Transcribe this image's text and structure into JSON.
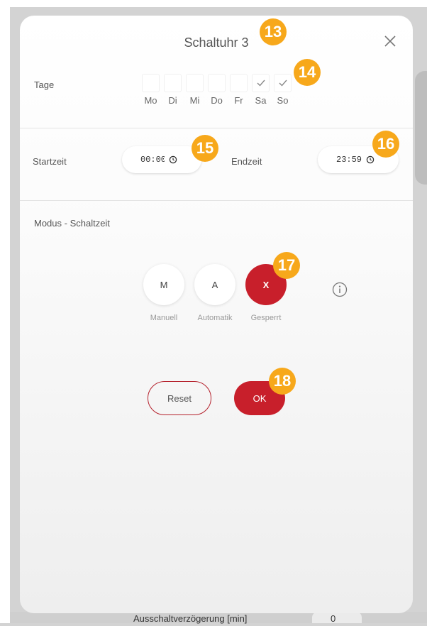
{
  "background": {
    "bottom_label": "Ausschaltverzögerung [min]",
    "bottom_value": "0"
  },
  "dialog": {
    "title": "Schaltuhr 3",
    "close_icon": "close-icon"
  },
  "days": {
    "label": "Tage",
    "items": [
      {
        "label": "Mo",
        "checked": false
      },
      {
        "label": "Di",
        "checked": false
      },
      {
        "label": "Mi",
        "checked": false
      },
      {
        "label": "Do",
        "checked": false
      },
      {
        "label": "Fr",
        "checked": false
      },
      {
        "label": "Sa",
        "checked": true
      },
      {
        "label": "So",
        "checked": true
      }
    ]
  },
  "times": {
    "start_label": "Startzeit",
    "start_value": "00:00",
    "end_label": "Endzeit",
    "end_value": "23:59"
  },
  "mode": {
    "label": "Modus - Schaltzeit",
    "options": [
      {
        "letter": "M",
        "label": "Manuell",
        "active": false
      },
      {
        "letter": "A",
        "label": "Automatik",
        "active": false
      },
      {
        "letter": "X",
        "label": "Gesperrt",
        "active": true
      }
    ],
    "info_icon": "info-icon"
  },
  "actions": {
    "reset_label": "Reset",
    "ok_label": "OK"
  },
  "callouts": [
    "13",
    "14",
    "15",
    "16",
    "17",
    "18"
  ],
  "colors": {
    "accent": "#c81f2b",
    "callout": "#f7a81b"
  }
}
